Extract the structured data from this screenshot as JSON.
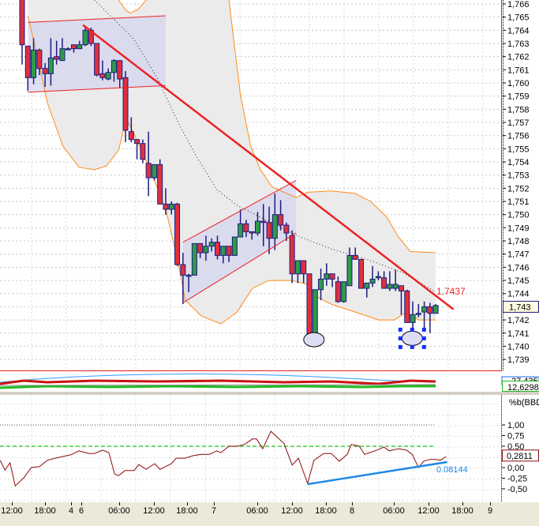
{
  "colors": {
    "up": "#2f9a47",
    "down": "#e0303c",
    "wick": "#1c1c80",
    "band": "#ff8c1a",
    "band_fill": "#ebebeb",
    "channel_fill": "#d6d6ef",
    "trend": "#ee2222",
    "pctb": "#8b0a0a",
    "support": "#1e88e8",
    "level_green": "#22cc22"
  },
  "price_axis": {
    "labels": [
      "1,766",
      "1,765",
      "1,764",
      "1,763",
      "1,762",
      "1,761",
      "1,760",
      "1,759",
      "1,758",
      "1,757",
      "1,756",
      "1,755",
      "1,754",
      "1,753",
      "1,752",
      "1,751",
      "1,750",
      "1,749",
      "1,748",
      "1,747",
      "1,746",
      "1,745",
      "1,744",
      "1,743",
      "1,742",
      "1,741",
      "1,740",
      "1,739"
    ],
    "values": [
      1.766,
      1.765,
      1.764,
      1.763,
      1.762,
      1.761,
      1.76,
      1.759,
      1.758,
      1.757,
      1.756,
      1.755,
      1.754,
      1.753,
      1.752,
      1.751,
      1.75,
      1.749,
      1.748,
      1.747,
      1.746,
      1.745,
      1.744,
      1.743,
      1.742,
      1.741,
      1.74,
      1.739
    ],
    "current_label": "1,743",
    "current_value": 1.743
  },
  "trendline_label": "1.7437",
  "candles": [
    [
      1.7675,
      1.7675,
      1.7614,
      1.7629
    ],
    [
      1.7628,
      1.7628,
      1.7594,
      1.7604
    ],
    [
      1.7604,
      1.7634,
      1.7599,
      1.7625
    ],
    [
      1.7625,
      1.7626,
      1.7606,
      1.7611
    ],
    [
      1.7611,
      1.7615,
      1.7597,
      1.7607
    ],
    [
      1.7607,
      1.7634,
      1.7598,
      1.7619
    ],
    [
      1.762,
      1.7632,
      1.7614,
      1.7618
    ],
    [
      1.7617,
      1.7634,
      1.7617,
      1.7626
    ],
    [
      1.7626,
      1.7627,
      1.7625,
      1.7626
    ],
    [
      1.7629,
      1.7629,
      1.7623,
      1.7626
    ],
    [
      1.7626,
      1.7632,
      1.7626,
      1.7629
    ],
    [
      1.7629,
      1.7643,
      1.7628,
      1.764
    ],
    [
      1.764,
      1.7642,
      1.7628,
      1.763
    ],
    [
      1.763,
      1.763,
      1.7605,
      1.7606
    ],
    [
      1.7607,
      1.7617,
      1.7602,
      1.7604
    ],
    [
      1.7603,
      1.7611,
      1.7602,
      1.7608
    ],
    [
      1.7608,
      1.7618,
      1.7601,
      1.7617
    ],
    [
      1.7617,
      1.7617,
      1.7596,
      1.7603
    ],
    [
      1.7604,
      1.7609,
      1.7555,
      1.7564
    ],
    [
      1.7563,
      1.7574,
      1.7555,
      1.7557
    ],
    [
      1.7557,
      1.7557,
      1.7542,
      1.7554
    ],
    [
      1.7554,
      1.7557,
      1.7539,
      1.7542
    ],
    [
      1.7539,
      1.7563,
      1.7514,
      1.7528
    ],
    [
      1.7528,
      1.7538,
      1.7526,
      1.7538
    ],
    [
      1.7538,
      1.7542,
      1.7508,
      1.7508
    ],
    [
      1.7508,
      1.752,
      1.75,
      1.7504
    ],
    [
      1.7504,
      1.751,
      1.75,
      1.7508
    ],
    [
      1.7508,
      1.7509,
      1.7461,
      1.7462
    ],
    [
      1.7462,
      1.7471,
      1.7432,
      1.7454
    ],
    [
      1.7454,
      1.7455,
      1.7441,
      1.7454
    ],
    [
      1.7454,
      1.7478,
      1.7454,
      1.7478
    ],
    [
      1.7478,
      1.7478,
      1.7467,
      1.7471
    ],
    [
      1.7471,
      1.7484,
      1.7465,
      1.7476
    ],
    [
      1.7476,
      1.7482,
      1.7472,
      1.7479
    ],
    [
      1.7479,
      1.7484,
      1.7466,
      1.7469
    ],
    [
      1.7469,
      1.7476,
      1.7463,
      1.7476
    ],
    [
      1.7476,
      1.7476,
      1.7464,
      1.7469
    ],
    [
      1.7469,
      1.7483,
      1.7469,
      1.7483
    ],
    [
      1.7483,
      1.7504,
      1.7483,
      1.7493
    ],
    [
      1.7493,
      1.7496,
      1.7483,
      1.7487
    ],
    [
      1.7487,
      1.7487,
      1.7481,
      1.7486
    ],
    [
      1.7486,
      1.7502,
      1.7484,
      1.7495
    ],
    [
      1.7495,
      1.7508,
      1.7476,
      1.7494
    ],
    [
      1.7494,
      1.7506,
      1.747,
      1.7482
    ],
    [
      1.7482,
      1.7516,
      1.7473,
      1.75
    ],
    [
      1.75,
      1.7511,
      1.7488,
      1.7492
    ],
    [
      1.7492,
      1.7494,
      1.748,
      1.7486
    ],
    [
      1.7484,
      1.7488,
      1.7448,
      1.7455
    ],
    [
      1.7455,
      1.7465,
      1.7448,
      1.7465
    ],
    [
      1.7465,
      1.7465,
      1.7448,
      1.7455
    ],
    [
      1.7455,
      1.7455,
      1.7406,
      1.7409
    ],
    [
      1.741,
      1.7443,
      1.7405,
      1.7443
    ],
    [
      1.7443,
      1.7459,
      1.7435,
      1.7451
    ],
    [
      1.7451,
      1.7463,
      1.7446,
      1.7455
    ],
    [
      1.7455,
      1.7455,
      1.7445,
      1.7451
    ],
    [
      1.7449,
      1.7453,
      1.7433,
      1.7434
    ],
    [
      1.7434,
      1.7449,
      1.7433,
      1.7449
    ],
    [
      1.7446,
      1.7475,
      1.7446,
      1.7469
    ],
    [
      1.7469,
      1.7475,
      1.7466,
      1.7466
    ],
    [
      1.7466,
      1.7466,
      1.7444,
      1.7444
    ],
    [
      1.7444,
      1.7448,
      1.7437,
      1.7448
    ],
    [
      1.7448,
      1.7461,
      1.7445,
      1.7451
    ],
    [
      1.7452,
      1.7457,
      1.745,
      1.7453
    ],
    [
      1.7452,
      1.7457,
      1.7444,
      1.7444
    ],
    [
      1.7444,
      1.7457,
      1.7442,
      1.7447
    ],
    [
      1.7444,
      1.7458,
      1.7442,
      1.7447
    ],
    [
      1.7446,
      1.7446,
      1.7424,
      1.7442
    ],
    [
      1.7442,
      1.7443,
      1.7418,
      1.7418
    ],
    [
      1.7418,
      1.7434,
      1.741,
      1.7424
    ],
    [
      1.7425,
      1.7432,
      1.7422,
      1.7425
    ],
    [
      1.7426,
      1.7434,
      1.7414,
      1.743
    ],
    [
      1.743,
      1.7433,
      1.741,
      1.7425
    ],
    [
      1.7425,
      1.7432,
      1.7425,
      1.7431
    ]
  ],
  "bollinger_upper": [
    [
      1.0,
      1.768
    ],
    [
      16.8,
      1.768
    ],
    [
      16.8,
      1.7663
    ],
    [
      17.9,
      1.7656
    ],
    [
      18.8,
      1.7653
    ],
    [
      20.2,
      1.7656
    ],
    [
      21.6,
      1.7663
    ],
    [
      21.6,
      1.768
    ],
    [
      36.0,
      1.768
    ],
    [
      36.0,
      1.7663
    ],
    [
      38.0,
      1.7591
    ],
    [
      39.8,
      1.7552
    ],
    [
      41.5,
      1.7534
    ],
    [
      43.5,
      1.7521
    ],
    [
      45.6,
      1.7517
    ],
    [
      47.7,
      1.7513
    ],
    [
      49.7,
      1.7517
    ],
    [
      53.8,
      1.7518
    ],
    [
      58.0,
      1.7516
    ],
    [
      60.7,
      1.751
    ],
    [
      63.5,
      1.7498
    ],
    [
      65.5,
      1.7483
    ],
    [
      67.6,
      1.7472
    ],
    [
      72.0,
      1.7471
    ]
  ],
  "bollinger_lower": [
    [
      1.0,
      1.7651
    ],
    [
      2.3,
      1.7627
    ],
    [
      4.4,
      1.7585
    ],
    [
      7.1,
      1.7552
    ],
    [
      9.9,
      1.7536
    ],
    [
      12.6,
      1.7534
    ],
    [
      14.7,
      1.7537
    ],
    [
      16.8,
      1.7549
    ],
    [
      18.1,
      1.7573
    ],
    [
      19.5,
      1.7561
    ],
    [
      22.3,
      1.7534
    ],
    [
      25.0,
      1.7504
    ],
    [
      27.1,
      1.7465
    ],
    [
      28.4,
      1.7435
    ],
    [
      31.2,
      1.7423
    ],
    [
      34.6,
      1.7417
    ],
    [
      37.4,
      1.7426
    ],
    [
      40.1,
      1.7444
    ],
    [
      42.9,
      1.745
    ],
    [
      47.0,
      1.745
    ],
    [
      49.7,
      1.7447
    ],
    [
      51.1,
      1.7438
    ],
    [
      53.8,
      1.7432
    ],
    [
      58.0,
      1.7426
    ],
    [
      62.1,
      1.742
    ],
    [
      64.8,
      1.742
    ],
    [
      66.9,
      1.7426
    ],
    [
      69.0,
      1.742
    ],
    [
      72.0,
      1.742
    ]
  ],
  "bollinger_mid": [
    [
      12.6,
      1.7663
    ],
    [
      19.5,
      1.7633
    ],
    [
      23.6,
      1.7603
    ],
    [
      27.5,
      1.7567
    ],
    [
      30.5,
      1.7543
    ],
    [
      33.9,
      1.7519
    ],
    [
      37.4,
      1.7507
    ],
    [
      42.9,
      1.7495
    ],
    [
      48.4,
      1.7483
    ],
    [
      53.8,
      1.7474
    ],
    [
      60.7,
      1.7465
    ],
    [
      66.2,
      1.7456
    ],
    [
      71.7,
      1.7442
    ]
  ],
  "trendline": [
    [
      10.6,
      1.7644
    ],
    [
      75.1,
      1.7428
    ]
  ],
  "channel1": {
    "top": [
      [
        1.0,
        1.7646
      ],
      [
        25.0,
        1.7651
      ]
    ],
    "bottom": [
      [
        1.0,
        1.7593
      ],
      [
        25.0,
        1.7598
      ]
    ]
  },
  "channel2": {
    "top": [
      [
        28.0,
        1.7479
      ],
      [
        47.7,
        1.7526
      ]
    ],
    "bottom": [
      [
        28.0,
        1.7433
      ],
      [
        47.7,
        1.7486
      ]
    ]
  },
  "ellipses": [
    {
      "i": 50.8,
      "p": 1.7405,
      "selected": false
    },
    {
      "i": 67.9,
      "p": 1.7406,
      "selected": true
    }
  ],
  "middle_panel": {
    "label_blue": "27,435",
    "label_green": "12,6298"
  },
  "pctb_panel": {
    "title": "%b(BBD",
    "axis_labels": [
      "1,00",
      "0,75",
      "0,50",
      "0,25",
      "0,00",
      "-0,25",
      "-0,50"
    ],
    "axis_values": [
      1.0,
      0.75,
      0.5,
      0.25,
      0.0,
      -0.25,
      -0.5
    ],
    "current_label": "0,2811",
    "current_value": 0.2811,
    "support_label": "0.08144",
    "support_line": [
      [
        49.7,
        -0.39
      ],
      [
        74.0,
        0.13
      ]
    ],
    "level_lines": [
      1.0,
      0.5
    ],
    "series": [
      [
        -3.8,
        0.17
      ],
      [
        -3.0,
        -0.06
      ],
      [
        -2.1,
        0.11
      ],
      [
        -1.2,
        -0.43
      ],
      [
        0.3,
        -0.24
      ],
      [
        1.6,
        0.0
      ],
      [
        3.0,
        0.02
      ],
      [
        4.4,
        0.17
      ],
      [
        5.8,
        0.22
      ],
      [
        7.1,
        0.26
      ],
      [
        8.5,
        0.3
      ],
      [
        9.9,
        0.39
      ],
      [
        11.7,
        0.33
      ],
      [
        12.6,
        0.33
      ],
      [
        14.0,
        0.41
      ],
      [
        15.1,
        0.35
      ],
      [
        16.1,
        -0.15
      ],
      [
        16.8,
        -0.19
      ],
      [
        17.9,
        -0.07
      ],
      [
        19.5,
        -0.07
      ],
      [
        20.3,
        0.07
      ],
      [
        21.6,
        -0.04
      ],
      [
        23.1,
        0.09
      ],
      [
        24.0,
        -0.04
      ],
      [
        26.0,
        0.09
      ],
      [
        26.8,
        0.22
      ],
      [
        28.4,
        0.22
      ],
      [
        29.8,
        0.28
      ],
      [
        31.2,
        0.31
      ],
      [
        32.6,
        0.31
      ],
      [
        33.9,
        0.39
      ],
      [
        34.6,
        0.35
      ],
      [
        36.0,
        0.5
      ],
      [
        37.4,
        0.5
      ],
      [
        38.7,
        0.54
      ],
      [
        40.1,
        0.67
      ],
      [
        40.8,
        0.67
      ],
      [
        41.9,
        0.44
      ],
      [
        43.3,
        0.85
      ],
      [
        44.9,
        0.65
      ],
      [
        45.6,
        0.56
      ],
      [
        47.0,
        0.06
      ],
      [
        48.1,
        0.22
      ],
      [
        49.7,
        -0.37
      ],
      [
        50.8,
        0.17
      ],
      [
        52.5,
        0.33
      ],
      [
        53.8,
        0.33
      ],
      [
        55.2,
        0.15
      ],
      [
        56.6,
        0.31
      ],
      [
        57.3,
        0.54
      ],
      [
        58.7,
        0.5
      ],
      [
        59.6,
        0.31
      ],
      [
        61.4,
        0.39
      ],
      [
        63.0,
        0.48
      ],
      [
        63.9,
        0.39
      ],
      [
        65.5,
        0.44
      ],
      [
        66.9,
        0.41
      ],
      [
        67.9,
        0.31
      ],
      [
        69.0,
        0.0
      ],
      [
        69.9,
        0.15
      ],
      [
        71.0,
        0.19
      ],
      [
        72.0,
        0.19
      ],
      [
        72.8,
        0.17
      ],
      [
        73.8,
        0.26
      ]
    ]
  },
  "time_axis": [
    "12:00",
    "18:00",
    "4",
    "6",
    "06:00",
    "12:00",
    "18:00",
    "7",
    "06:00",
    "12:00",
    "18:00",
    "8",
    "06:00",
    "12:00",
    "18:00",
    "9"
  ]
}
